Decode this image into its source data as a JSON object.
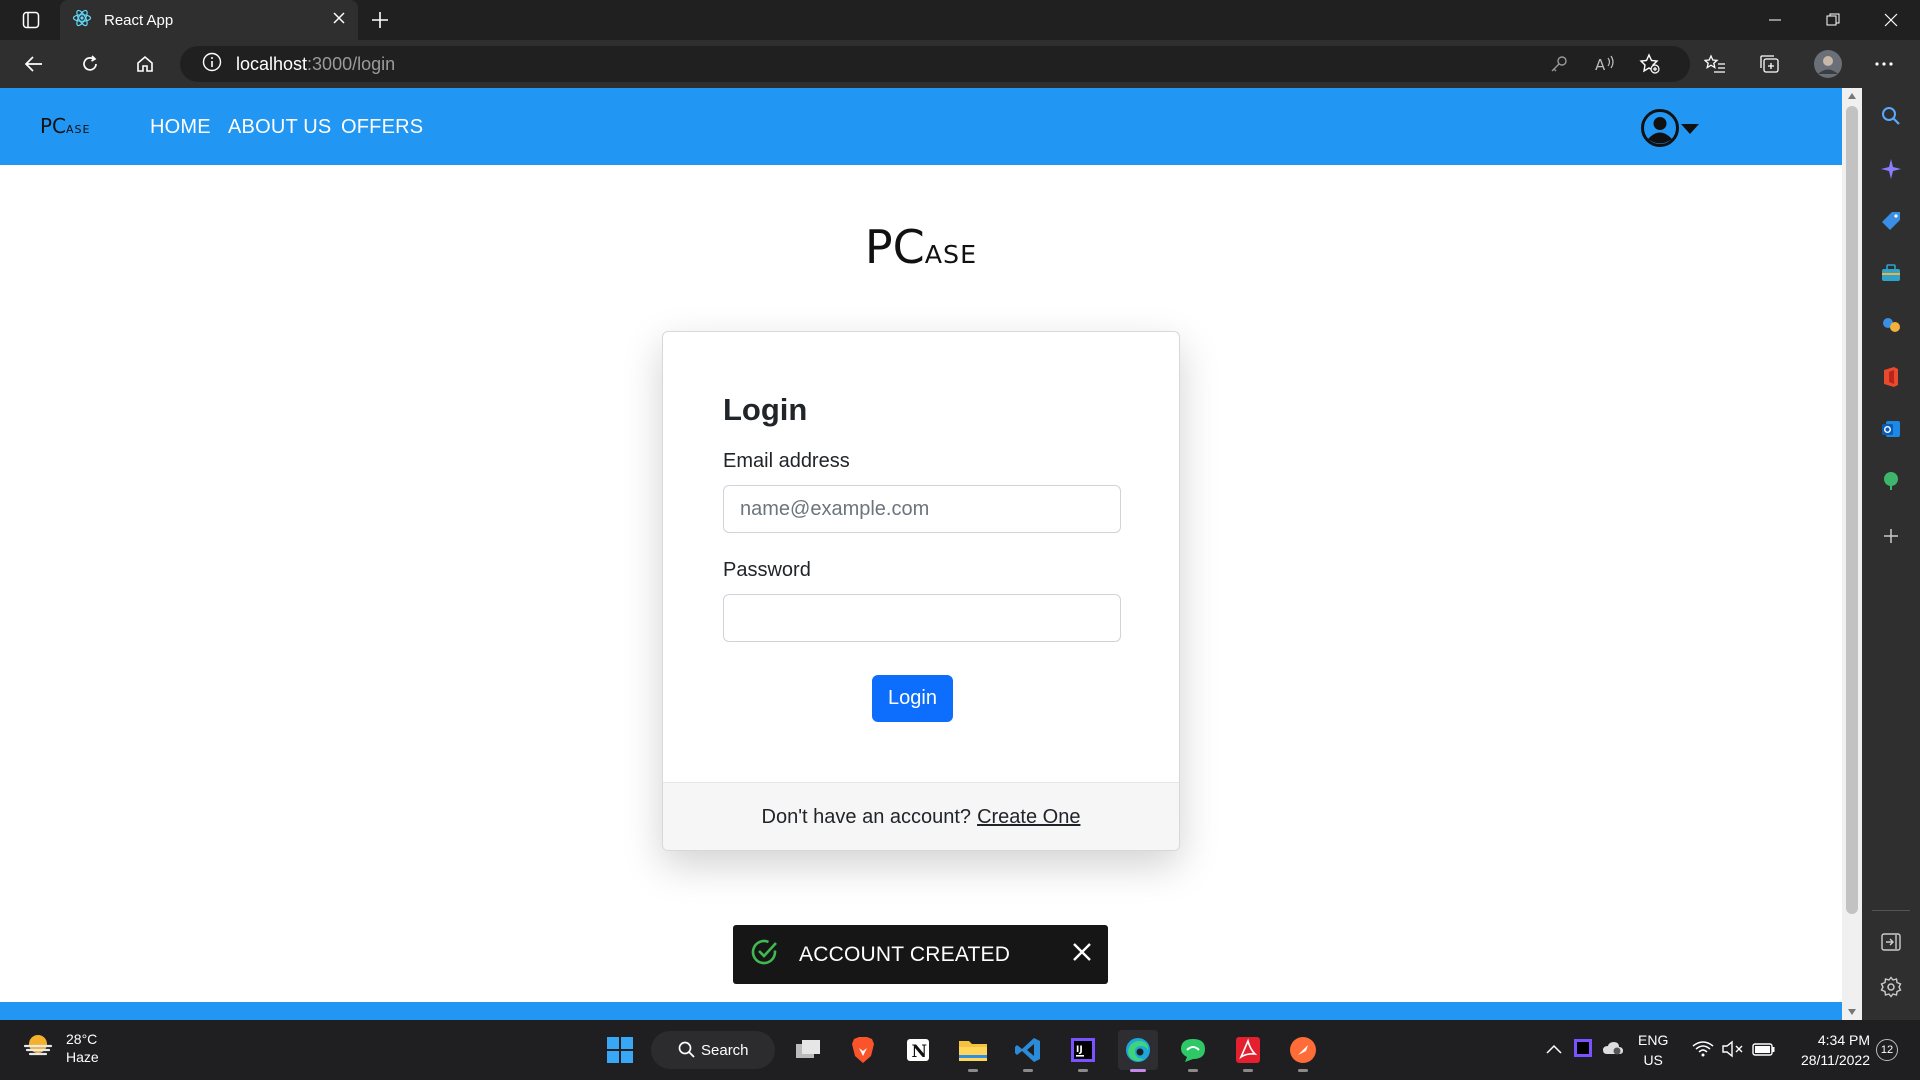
{
  "browser": {
    "tab_title": "React App",
    "address_host": "localhost",
    "address_path": ":3000/login"
  },
  "site": {
    "brand_big": "PC",
    "brand_small": "ASE",
    "nav": [
      {
        "label": "HOME"
      },
      {
        "label": "ABOUT US"
      },
      {
        "label": "OFFERS"
      }
    ],
    "accent": "#2196f3"
  },
  "login": {
    "title": "Login",
    "email_label": "Email address",
    "email_placeholder": "name@example.com",
    "password_label": "Password",
    "submit_label": "Login",
    "footer_text": "Don't have an account?",
    "footer_link": "Create One"
  },
  "toast": {
    "message": "ACCOUNT CREATED",
    "status": "success"
  },
  "taskbar": {
    "weather_temp": "28°C",
    "weather_desc": "Haze",
    "search_label": "Search",
    "lang_line1": "ENG",
    "lang_line2": "US",
    "time": "4:34 PM",
    "date": "28/11/2022",
    "notification_count": "12"
  }
}
